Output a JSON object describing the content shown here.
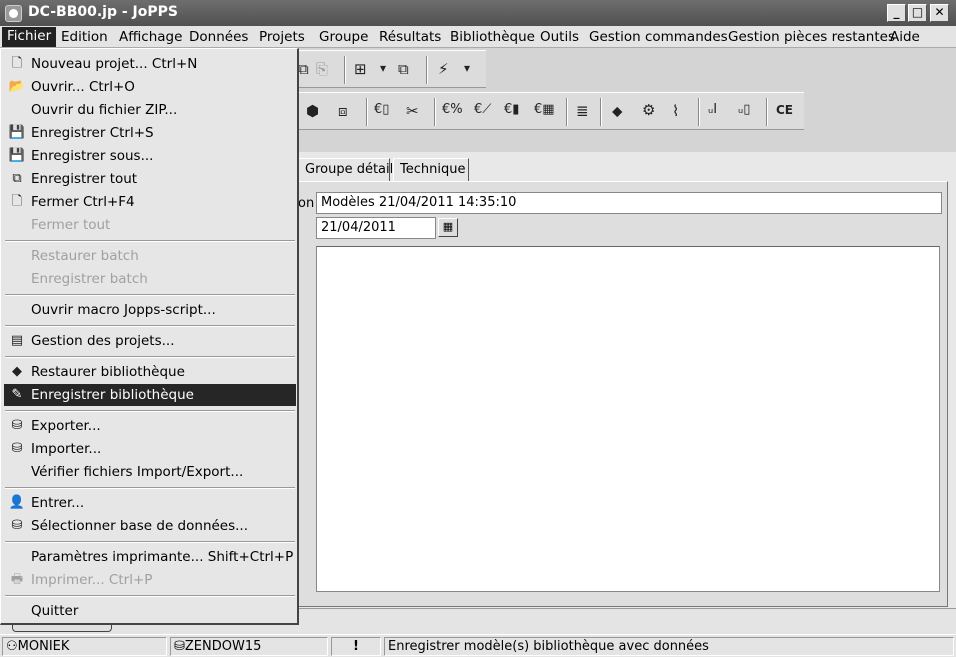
{
  "window": {
    "title": "DC-BB00.jp - JoPPS",
    "min_glyph": "_",
    "max_glyph": "□",
    "close_glyph": "✕"
  },
  "menubar": [
    {
      "label": "Fichier"
    },
    {
      "label": "Edition"
    },
    {
      "label": "Affichage"
    },
    {
      "label": "Données"
    },
    {
      "label": "Projets"
    },
    {
      "label": "Groupe"
    },
    {
      "label": "Résultats"
    },
    {
      "label": "Bibliothèque"
    },
    {
      "label": "Outils"
    },
    {
      "label": "Gestion commandes"
    },
    {
      "label": "Gestion pièces restantes"
    },
    {
      "label": "Aide"
    }
  ],
  "file_menu": {
    "items": [
      {
        "label": "Nouveau projet... Ctrl+N",
        "icon": "new-project-icon",
        "glyph": "🗋",
        "disabled": false,
        "selected": false
      },
      {
        "label": "Ouvrir... Ctrl+O",
        "icon": "open-folder-icon",
        "glyph": "📂",
        "disabled": false,
        "selected": false
      },
      {
        "label": "Ouvrir du fichier ZIP...",
        "icon": "",
        "glyph": "",
        "disabled": false,
        "selected": false
      },
      {
        "label": "Enregistrer Ctrl+S",
        "icon": "save-icon",
        "glyph": "💾",
        "disabled": false,
        "selected": false
      },
      {
        "label": "Enregistrer sous...",
        "icon": "save-as-icon",
        "glyph": "💾",
        "disabled": false,
        "selected": false
      },
      {
        "label": "Enregistrer tout",
        "icon": "save-all-icon",
        "glyph": "⧉",
        "disabled": false,
        "selected": false
      },
      {
        "label": "Fermer Ctrl+F4",
        "icon": "close-file-icon",
        "glyph": "🗋",
        "disabled": false,
        "selected": false
      },
      {
        "label": "Fermer tout",
        "icon": "",
        "glyph": "",
        "disabled": true,
        "selected": false
      },
      {
        "label": "Restaurer batch",
        "icon": "",
        "glyph": "",
        "disabled": true,
        "selected": false
      },
      {
        "label": "Enregistrer batch",
        "icon": "",
        "glyph": "",
        "disabled": true,
        "selected": false
      },
      {
        "label": "Ouvrir macro Jopps-script...",
        "icon": "",
        "glyph": "",
        "disabled": false,
        "selected": false
      },
      {
        "label": "Gestion des projets...",
        "icon": "project-manager-icon",
        "glyph": "▤",
        "disabled": false,
        "selected": false
      },
      {
        "label": "Restaurer bibliothèque",
        "icon": "restore-library-icon",
        "glyph": "◆",
        "disabled": false,
        "selected": false
      },
      {
        "label": "Enregistrer bibliothèque",
        "icon": "save-library-icon",
        "glyph": "✎",
        "disabled": false,
        "selected": true
      },
      {
        "label": "Exporter...",
        "icon": "export-icon",
        "glyph": "⛁",
        "disabled": false,
        "selected": false
      },
      {
        "label": "Importer...",
        "icon": "import-icon",
        "glyph": "⛁",
        "disabled": false,
        "selected": false
      },
      {
        "label": "Vérifier fichiers Import/Export...",
        "icon": "",
        "glyph": "",
        "disabled": false,
        "selected": false
      },
      {
        "label": "Entrer...",
        "icon": "user-login-icon",
        "glyph": "👤",
        "disabled": false,
        "selected": false
      },
      {
        "label": "Sélectionner base de données...",
        "icon": "database-select-icon",
        "glyph": "⛁",
        "disabled": false,
        "selected": false
      },
      {
        "label": "Paramètres imprimante... Shift+Ctrl+P",
        "icon": "",
        "glyph": "",
        "disabled": false,
        "selected": false
      },
      {
        "label": "Imprimer... Ctrl+P",
        "icon": "printer-icon",
        "glyph": "🖶",
        "disabled": true,
        "selected": false
      },
      {
        "label": "Quitter",
        "icon": "",
        "glyph": "",
        "disabled": false,
        "selected": false
      }
    ]
  },
  "toolbar1": [
    {
      "icon": "copy-icon",
      "glyph": "⧉"
    },
    {
      "icon": "paste-icon",
      "glyph": "⎘"
    },
    {
      "icon": "grid-icon",
      "glyph": "⊞"
    },
    {
      "icon": "dropdown-arrow-icon",
      "glyph": "▾"
    },
    {
      "icon": "windows-icon",
      "glyph": "⧉"
    },
    {
      "icon": "lightning-icon",
      "glyph": "⚡"
    },
    {
      "icon": "dropdown-arrow-icon",
      "glyph": "▾"
    }
  ],
  "toolbar2": [
    {
      "icon": "cube-icon",
      "glyph": "⬢"
    },
    {
      "icon": "profile-icon",
      "glyph": "⧈"
    },
    {
      "icon": "euro-profile-icon",
      "glyph": "€▯"
    },
    {
      "icon": "euro-cut-icon",
      "glyph": "✂"
    },
    {
      "icon": "euro-percent-icon",
      "glyph": "€%"
    },
    {
      "icon": "euro-chart-icon",
      "glyph": "€⟋"
    },
    {
      "icon": "euro-bar-icon",
      "glyph": "€▮"
    },
    {
      "icon": "euro-table-icon",
      "glyph": "€▦"
    },
    {
      "icon": "stack-icon",
      "glyph": "≣"
    },
    {
      "icon": "arrow-icon",
      "glyph": "⬥"
    },
    {
      "icon": "gear-icon",
      "glyph": "⚙"
    },
    {
      "icon": "drill-icon",
      "glyph": "⌇"
    },
    {
      "icon": "measure-icon",
      "glyph": "ᵤI"
    },
    {
      "icon": "measure-profile-icon",
      "glyph": "ᵤ▯"
    },
    {
      "icon": "ce-mark-icon",
      "glyph": "CE"
    }
  ],
  "tabs": [
    {
      "label": "Groupe détail"
    },
    {
      "label": "Technique"
    }
  ],
  "form": {
    "description_label_fragment": "on",
    "description_value": "Modèles 21/04/2011 14:35:10",
    "date_value": "21/04/2011",
    "calendar_glyph": "▦"
  },
  "statusbar": {
    "user": "MONIEK",
    "database": "ZENDOW15",
    "alert": "!",
    "message": "Enregistrer modèle(s) bibliothèque avec données"
  }
}
